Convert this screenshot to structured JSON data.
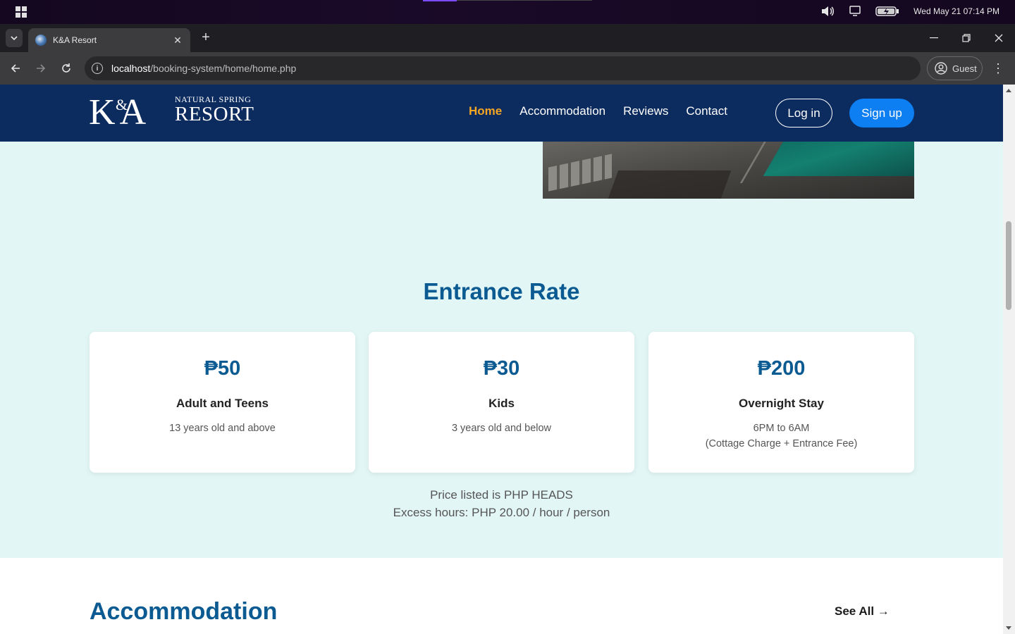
{
  "os": {
    "datetime": "Wed May 21  07:14 PM"
  },
  "browser": {
    "tab_title": "K&A Resort",
    "url_host": "localhost",
    "url_path": "/booking-system/home/home.php",
    "profile_label": "Guest"
  },
  "site": {
    "logo": {
      "initials": "K A",
      "ampersand": "&",
      "tagline": "NATURAL SPRING",
      "name": "RESORT"
    },
    "nav": [
      {
        "label": "Home",
        "active": true
      },
      {
        "label": "Accommodation",
        "active": false
      },
      {
        "label": "Reviews",
        "active": false
      },
      {
        "label": "Contact",
        "active": false
      }
    ],
    "login_label": "Log in",
    "signup_label": "Sign up"
  },
  "entrance": {
    "title": "Entrance Rate",
    "cards": [
      {
        "price": "₱50",
        "label": "Adult and Teens",
        "desc": [
          "13 years old and above"
        ]
      },
      {
        "price": "₱30",
        "label": "Kids",
        "desc": [
          "3 years old and below"
        ]
      },
      {
        "price": "₱200",
        "label": "Overnight Stay",
        "desc": [
          "6PM to 6AM",
          "(Cottage Charge + Entrance Fee)"
        ]
      }
    ],
    "note_line1": "Price listed is PHP HEADS",
    "note_line2": "Excess hours: PHP 20.00 / hour / person"
  },
  "accommodation": {
    "title": "Accommodation",
    "see_all": "See All →"
  },
  "colors": {
    "header_bg": "#0c2b5e",
    "accent_active": "#f5a623",
    "primary_button": "#0d7ff2",
    "section_title": "#0b5b92",
    "page_bg": "#e3f6f6"
  }
}
